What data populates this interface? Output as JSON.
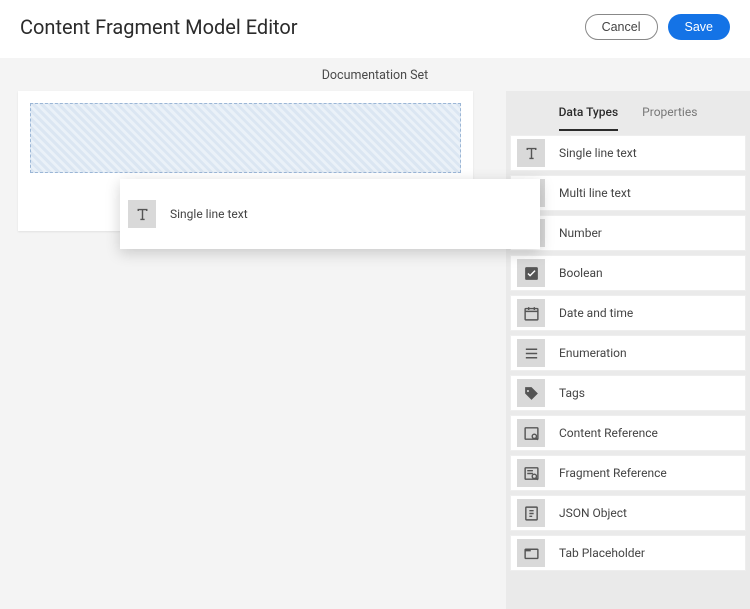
{
  "header": {
    "title": "Content Fragment Model Editor",
    "cancel_label": "Cancel",
    "save_label": "Save"
  },
  "subheader": {
    "title": "Documentation Set"
  },
  "dragging": {
    "label": "Single line text"
  },
  "sidepanel": {
    "tabs": {
      "datatypes_label": "Data Types",
      "properties_label": "Properties"
    },
    "types": [
      {
        "icon": "text",
        "label": "Single line text"
      },
      {
        "icon": "multitext",
        "label": "Multi line text"
      },
      {
        "icon": "number",
        "label": "Number"
      },
      {
        "icon": "boolean",
        "label": "Boolean"
      },
      {
        "icon": "date",
        "label": "Date and time"
      },
      {
        "icon": "enum",
        "label": "Enumeration"
      },
      {
        "icon": "tags",
        "label": "Tags"
      },
      {
        "icon": "contentref",
        "label": "Content Reference"
      },
      {
        "icon": "fragmentref",
        "label": "Fragment Reference"
      },
      {
        "icon": "json",
        "label": "JSON Object"
      },
      {
        "icon": "tab",
        "label": "Tab Placeholder"
      }
    ]
  }
}
